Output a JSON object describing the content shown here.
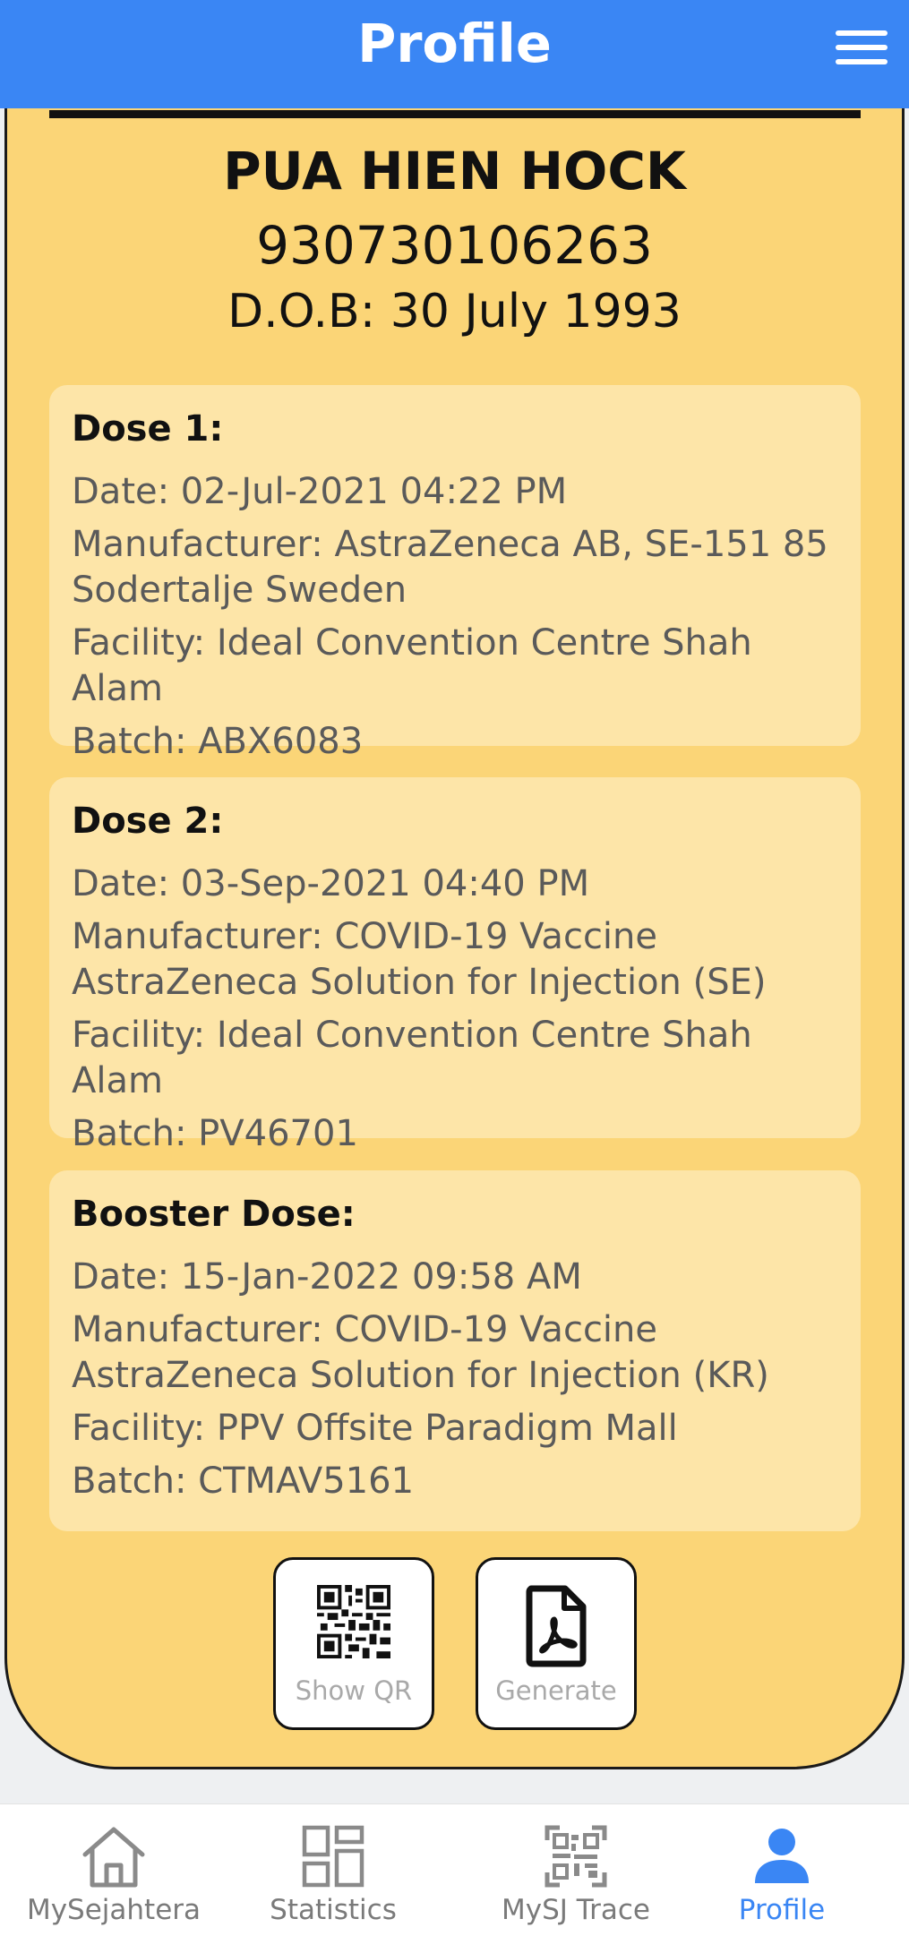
{
  "header": {
    "title": "Profile",
    "menu_icon": "hamburger-menu-icon"
  },
  "profile": {
    "name": "PUA HIEN HOCK",
    "id_number": "930730106263",
    "dob": "D.O.B: 30 July 1993"
  },
  "doses": [
    {
      "title": "Dose 1:",
      "date": "Date: 02-Jul-2021 04:22 PM",
      "manufacturer_line1": "Manufacturer: AstraZeneca AB, SE-151 85",
      "manufacturer_line2": "Sodertalje Sweden",
      "facility": "Facility: Ideal Convention Centre Shah Alam",
      "batch": "Batch: ABX6083"
    },
    {
      "title": "Dose 2:",
      "date": "Date: 03-Sep-2021 04:40 PM",
      "manufacturer_line1": "Manufacturer: COVID-19 Vaccine",
      "manufacturer_line2": "AstraZeneca Solution for Injection (SE)",
      "facility": "Facility: Ideal Convention Centre Shah Alam",
      "batch": "Batch: PV46701"
    },
    {
      "title": "Booster Dose:",
      "date": "Date: 15-Jan-2022 09:58 AM",
      "manufacturer_line1": "Manufacturer: COVID-19 Vaccine",
      "manufacturer_line2": "AstraZeneca Solution for Injection (KR)",
      "facility": "Facility: PPV Offsite Paradigm Mall",
      "batch": "Batch: CTMAV5161"
    }
  ],
  "actions": {
    "show_qr_label": "Show QR",
    "show_qr_icon": "qr-code-icon",
    "generate_label": "Generate",
    "generate_icon": "pdf-document-icon"
  },
  "bottom_nav": {
    "items": [
      {
        "label": "MySejahtera",
        "icon": "home-icon",
        "active": false
      },
      {
        "label": "Statistics",
        "icon": "grid-icon",
        "active": false
      },
      {
        "label": "MySJ Trace",
        "icon": "qr-trace-icon",
        "active": false
      },
      {
        "label": "Profile",
        "icon": "person-icon",
        "active": true
      }
    ]
  },
  "colors": {
    "header_blue": "#3a86f4",
    "card_yellow": "#fbd577",
    "panel_yellow": "#fde5a8",
    "active_nav": "#3a86f4",
    "inactive_nav": "#7a7a7a"
  }
}
